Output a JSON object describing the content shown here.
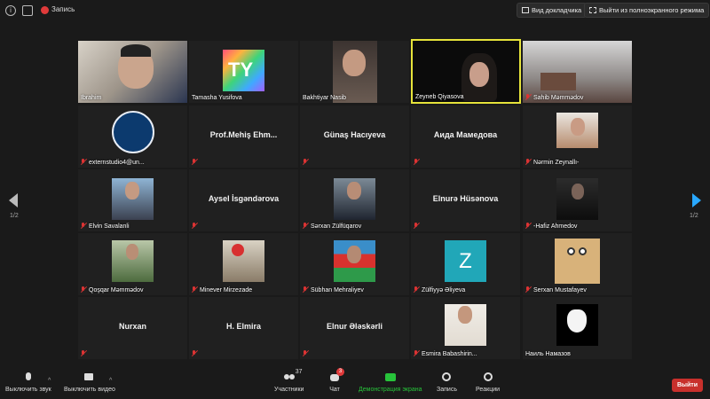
{
  "topbar": {
    "recording_label": "Запись",
    "view_button_label": "Вид докладчика",
    "exit_fullscreen_label": "Выйти из полноэкранного режима"
  },
  "tiles": [
    {
      "name": "Ibrahim",
      "type": "video",
      "muted": false
    },
    {
      "name": "Tamasha Yusifova",
      "type": "logo",
      "muted": false
    },
    {
      "name": "Bakhtiyar Nasib",
      "type": "video",
      "muted": false
    },
    {
      "name": "Zeyneb Qiyasova",
      "type": "video",
      "muted": false,
      "active": true
    },
    {
      "name": "Sahib Məmmədov",
      "type": "video",
      "muted": true
    },
    {
      "name": "externstudio4@un...",
      "type": "photo",
      "muted": true
    },
    {
      "name": "Prof.Mehiş  Ehm...",
      "type": "text",
      "muted": true
    },
    {
      "name": "Günaş Hacıyeva",
      "type": "text",
      "muted": true
    },
    {
      "name": "Аида Мамедова",
      "type": "text",
      "muted": true
    },
    {
      "name": "Nərmin Zeynallı-",
      "type": "photo",
      "muted": true
    },
    {
      "name": "Elvin Savalanli",
      "type": "photo",
      "muted": true
    },
    {
      "name": "Aysel İsgəndərova",
      "type": "text",
      "muted": true
    },
    {
      "name": "Sərxan Zülfüqarov",
      "type": "photo",
      "muted": true
    },
    {
      "name": "Elnurə Hüsənova",
      "type": "text",
      "muted": true
    },
    {
      "name": "-Hafiz Ahmedov",
      "type": "photo",
      "muted": true
    },
    {
      "name": "Qoşqar Məmmədov",
      "type": "photo",
      "muted": true
    },
    {
      "name": "Minever Mirzezade",
      "type": "photo",
      "muted": true
    },
    {
      "name": "Sübhan Mehraliyev",
      "type": "photo",
      "muted": true
    },
    {
      "name": "Zülfiyyə Əliyeva",
      "type": "avatar",
      "avatar_letter": "Z",
      "muted": true
    },
    {
      "name": "Serxan Mustafayev",
      "type": "photo",
      "muted": true
    },
    {
      "name": "Nurxan",
      "type": "text",
      "muted": true
    },
    {
      "name": "H. Elmira",
      "type": "text",
      "muted": true
    },
    {
      "name": "Elnur Ələskərli",
      "type": "text",
      "muted": true
    },
    {
      "name": "Esmira Babashirin...",
      "type": "photo",
      "muted": true
    },
    {
      "name": "Наиль Намазов",
      "type": "photo",
      "muted": true
    }
  ],
  "pagination": {
    "left": "1/2",
    "right": "1/2"
  },
  "toolbar": {
    "mute_label": "Выключить звук",
    "video_label": "Выключить видео",
    "participants_label": "Участники",
    "participants_count": "37",
    "chat_label": "Чат",
    "chat_badge": "3",
    "share_label": "Демонстрация экрана",
    "record_label": "Запись",
    "reactions_label": "Реакции",
    "leave_label": "Выйти"
  },
  "colors": {
    "active_speaker_border": "#e6e33a",
    "share_green": "#27c33a",
    "leave_red": "#c8302c",
    "avatar_teal": "#21a7b8"
  }
}
